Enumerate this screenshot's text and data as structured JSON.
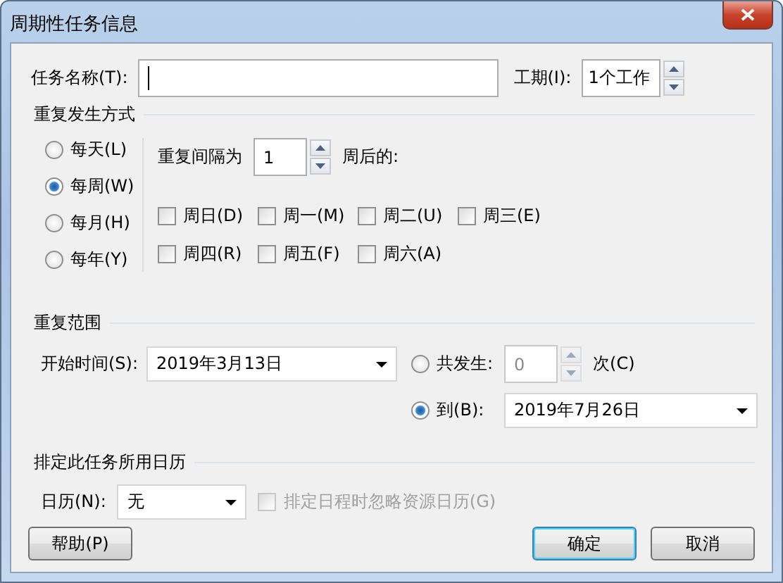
{
  "window": {
    "title": "周期性任务信息"
  },
  "task_name": {
    "label": "任务名称(T):"
  },
  "duration": {
    "label": "工期(I):",
    "value": "1个工作"
  },
  "recurrence": {
    "title": "重复发生方式",
    "interval_label": "重复间隔为",
    "interval": "1",
    "interval_suffix": "周后的:",
    "patterns": [
      {
        "label": "每天(L)",
        "selected": false
      },
      {
        "label": "每周(W)",
        "selected": true
      },
      {
        "label": "每月(H)",
        "selected": false
      },
      {
        "label": "每年(Y)",
        "selected": false
      }
    ],
    "days": [
      {
        "label": "周日(D)",
        "checked": false
      },
      {
        "label": "周一(M)",
        "checked": false
      },
      {
        "label": "周二(U)",
        "checked": false
      },
      {
        "label": "周三(E)",
        "checked": false
      },
      {
        "label": "周四(R)",
        "checked": false
      },
      {
        "label": "周五(F)",
        "checked": false
      },
      {
        "label": "周六(A)",
        "checked": false
      }
    ]
  },
  "range": {
    "title": "重复范围",
    "start_label": "开始时间(S):",
    "start": "2019年3月13日",
    "options": [
      {
        "kind": "count",
        "label": "共发生:",
        "selected": false,
        "value": "0",
        "suffix": "次(C)"
      },
      {
        "kind": "date",
        "label": "到(B):",
        "selected": true,
        "value": "2019年7月26日"
      }
    ]
  },
  "calendar": {
    "title": "排定此任务所用日历",
    "label": "日历(N):",
    "value": "无",
    "ignore": {
      "label": "排定日程时忽略资源日历(G)",
      "checked": false,
      "disabled": true
    }
  },
  "buttons": [
    {
      "label": "帮助(P)",
      "default": false
    },
    {
      "label": "确定",
      "default": true
    },
    {
      "label": "取消",
      "default": false
    }
  ]
}
